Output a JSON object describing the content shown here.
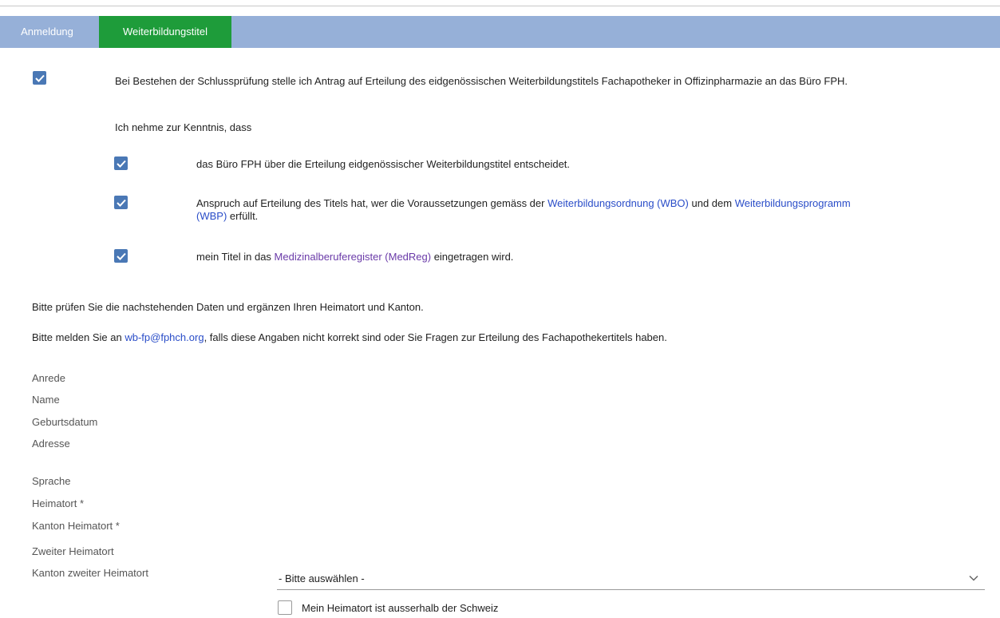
{
  "tabs": [
    {
      "label": "Anmeldung",
      "active": false
    },
    {
      "label": "Weiterbildungstitel",
      "active": true
    }
  ],
  "colors": {
    "tabbar": "#96b0d8",
    "active_tab": "#1e9c3a",
    "checkbox": "#4a78b5",
    "link": "#2a4dc8"
  },
  "main_consent": {
    "checked": true,
    "text": "Bei Bestehen der Schlussprüfung stelle ich Antrag auf Erteilung des eidgenössischen Weiterbildungstitels Fachapotheker in Offizinpharmazie an das Büro FPH."
  },
  "acknowledge_intro": "Ich nehme zur Kenntnis, dass",
  "ack1": {
    "checked": true,
    "text": "das Büro FPH über die Erteilung eidgenössischer Weiterbildungstitel entscheidet."
  },
  "ack2": {
    "checked": true,
    "text_a": "Anspruch auf Erteilung des Titels hat, wer die Voraussetzungen gemäss der ",
    "link_wbo": "Weiterbildungsordnung (WBO)",
    "text_b": " und dem ",
    "link_wbp": "Weiterbildungsprogramm (WBP)",
    "text_c": " erfüllt."
  },
  "ack3": {
    "checked": true,
    "text_a": "mein Titel in das ",
    "link_medreg": "Medizinalberuferegister (MedReg)",
    "text_b": " eingetragen wird."
  },
  "info": {
    "check_data": "Bitte prüfen Sie die nachstehenden Daten und ergänzen Ihren Heimatort und Kanton.",
    "contact_a": "Bitte melden Sie an ",
    "contact_email": "wb-fp@fphch.org",
    "contact_b": ", falls diese Angaben nicht korrekt sind oder Sie Fragen zur Erteilung des Fachapothekertitels haben."
  },
  "fields": {
    "anrede": "Anrede",
    "name": "Name",
    "geburtsdatum": "Geburtsdatum",
    "adresse": "Adresse",
    "sprache": "Sprache",
    "heimatort": "Heimatort *",
    "kanton_heimatort": "Kanton Heimatort *",
    "zweiter_heimatort": "Zweiter Heimatort",
    "kanton_zweiter_heimatort": "Kanton zweiter Heimatort"
  },
  "kanton_select": {
    "value": "- Bitte auswählen -",
    "icon": "chevron-down-icon"
  },
  "abroad_checkbox": {
    "checked": false,
    "label": "Mein Heimatort ist ausserhalb der Schweiz"
  }
}
